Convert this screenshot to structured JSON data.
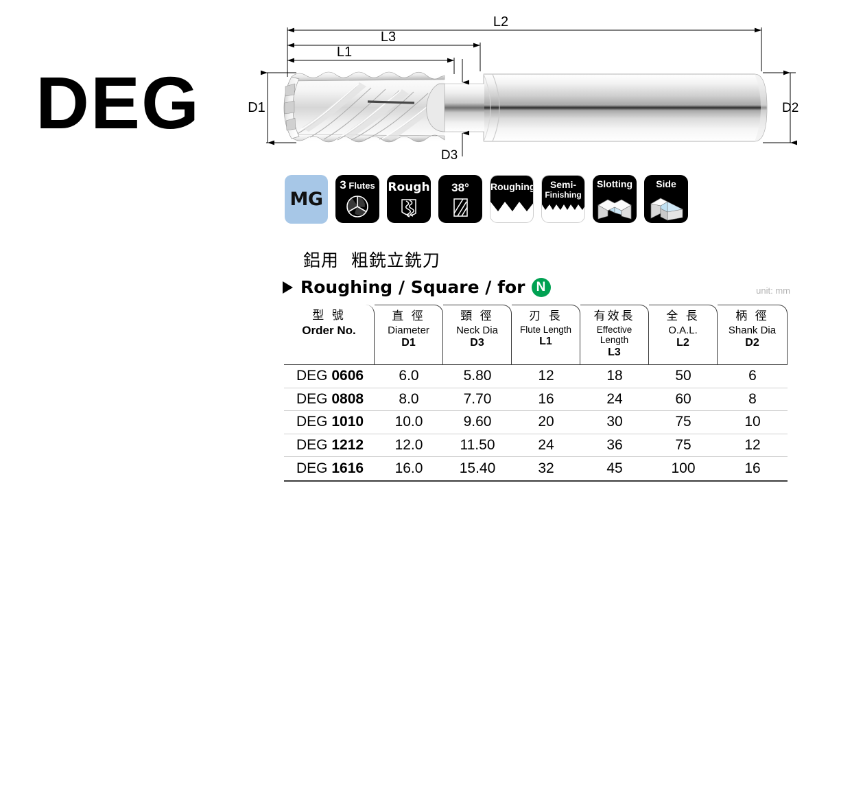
{
  "product": {
    "series_code": "DEG",
    "title_cn": "鋁用  粗銑立銑刀",
    "title_en": "Roughing / Square / for",
    "material_badge": "N",
    "material_badge_color": "#00a152",
    "unit_note": "unit: mm"
  },
  "diagram": {
    "labels": {
      "d1": "D1",
      "d2": "D2",
      "d3": "D3",
      "l1": "L1",
      "l2": "L2",
      "l3": "L3"
    }
  },
  "badges": [
    {
      "name": "mg",
      "text": "MG",
      "style": "blue",
      "bg": "#a7c7e7"
    },
    {
      "name": "3-flutes",
      "line1": "3",
      "line2": "Flutes",
      "style": "black",
      "icon": "three-flutes-icon"
    },
    {
      "name": "rough",
      "text": "Rough",
      "style": "black",
      "icon": "serrated-flute-icon"
    },
    {
      "name": "helix-angle",
      "text": "38°",
      "style": "black",
      "icon": "helix-angle-icon"
    },
    {
      "name": "roughing",
      "text": "Roughing",
      "style": "zigzag-coarse"
    },
    {
      "name": "semi-finishing",
      "line1": "Semi-",
      "line2": "Finishing",
      "style": "zigzag-fine"
    },
    {
      "name": "slotting",
      "text": "Slotting",
      "style": "black",
      "icon": "slotting-block-icon"
    },
    {
      "name": "side",
      "text": "Side",
      "style": "black",
      "icon": "side-step-block-icon"
    }
  ],
  "table": {
    "columns": [
      {
        "cn": "型 號",
        "en": "Order No.",
        "sym": "",
        "en_bold": true
      },
      {
        "cn": "直 徑",
        "en": "Diameter",
        "sym": "D1"
      },
      {
        "cn": "頸 徑",
        "en": "Neck Dia",
        "sym": "D3"
      },
      {
        "cn": "刃 長",
        "en": "Flute Length",
        "sym": "L1",
        "small": true
      },
      {
        "cn": "有效長",
        "en": "Effective Length",
        "sym": "L3",
        "small": true
      },
      {
        "cn": "全 長",
        "en": "O.A.L.",
        "sym": "L2"
      },
      {
        "cn": "柄 徑",
        "en": "Shank Dia",
        "sym": "D2"
      }
    ],
    "rows": [
      {
        "prefix": "DEG ",
        "code": "0606",
        "d1": "6.0",
        "d3": "5.80",
        "l1": "12",
        "l3": "18",
        "l2": "50",
        "d2": "6"
      },
      {
        "prefix": "DEG ",
        "code": "0808",
        "d1": "8.0",
        "d3": "7.70",
        "l1": "16",
        "l3": "24",
        "l2": "60",
        "d2": "8"
      },
      {
        "prefix": "DEG ",
        "code": "1010",
        "d1": "10.0",
        "d3": "9.60",
        "l1": "20",
        "l3": "30",
        "l2": "75",
        "d2": "10"
      },
      {
        "prefix": "DEG ",
        "code": "1212",
        "d1": "12.0",
        "d3": "11.50",
        "l1": "24",
        "l3": "36",
        "l2": "75",
        "d2": "12"
      },
      {
        "prefix": "DEG ",
        "code": "1616",
        "d1": "16.0",
        "d3": "15.40",
        "l1": "32",
        "l3": "45",
        "l2": "100",
        "d2": "16"
      }
    ]
  }
}
